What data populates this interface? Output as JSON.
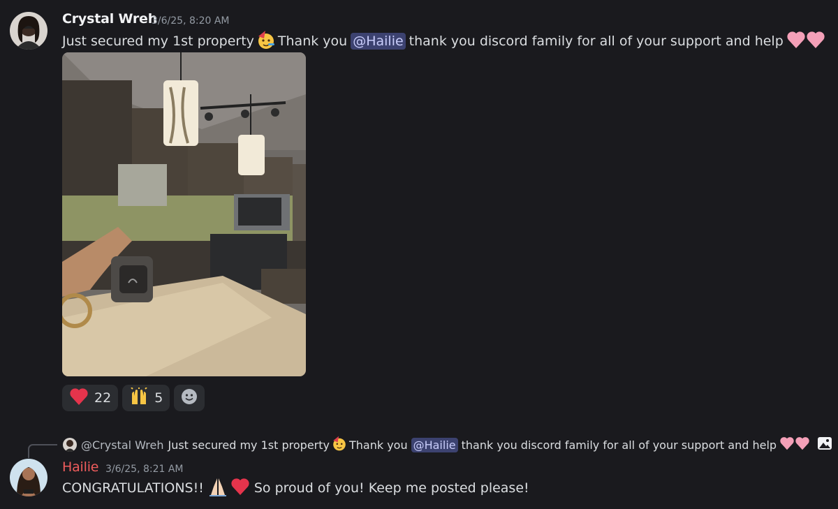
{
  "messages": [
    {
      "author": "Crystal Wreh",
      "timestamp": "3/6/25, 8:20 AM",
      "text_before": "Just secured my 1st property",
      "text_mid": "Thank you",
      "mention": "@Hailie",
      "text_after": "thank you discord family for all of your support and help",
      "emojis": [
        "party-face",
        "pink-heart",
        "pink-heart"
      ],
      "attachment": "kitchen photo with keys",
      "reactions": [
        {
          "emoji": "red-heart",
          "count": "22"
        },
        {
          "emoji": "raising-hands",
          "count": "5"
        }
      ]
    },
    {
      "author": "Hailie",
      "timestamp": "3/6/25, 8:21 AM",
      "reply_to": {
        "author": "@Crystal Wreh",
        "text_before": "Just secured my 1st property",
        "text_mid": "Thank you",
        "mention": "@Hailie",
        "text_after": "thank you discord family for all of your support and help"
      },
      "text_before": "CONGRATULATIONS!!",
      "text_after": "So proud of you! Keep me posted please!",
      "emojis": [
        "folded-hands",
        "red-heart"
      ]
    }
  ],
  "colors": {
    "background": "#1a1a1e",
    "mention_bg": "#3c4270",
    "mention_text": "#c9cdfb",
    "hailie_name": "#f05d5d",
    "reaction_bg": "#2b2d31"
  }
}
